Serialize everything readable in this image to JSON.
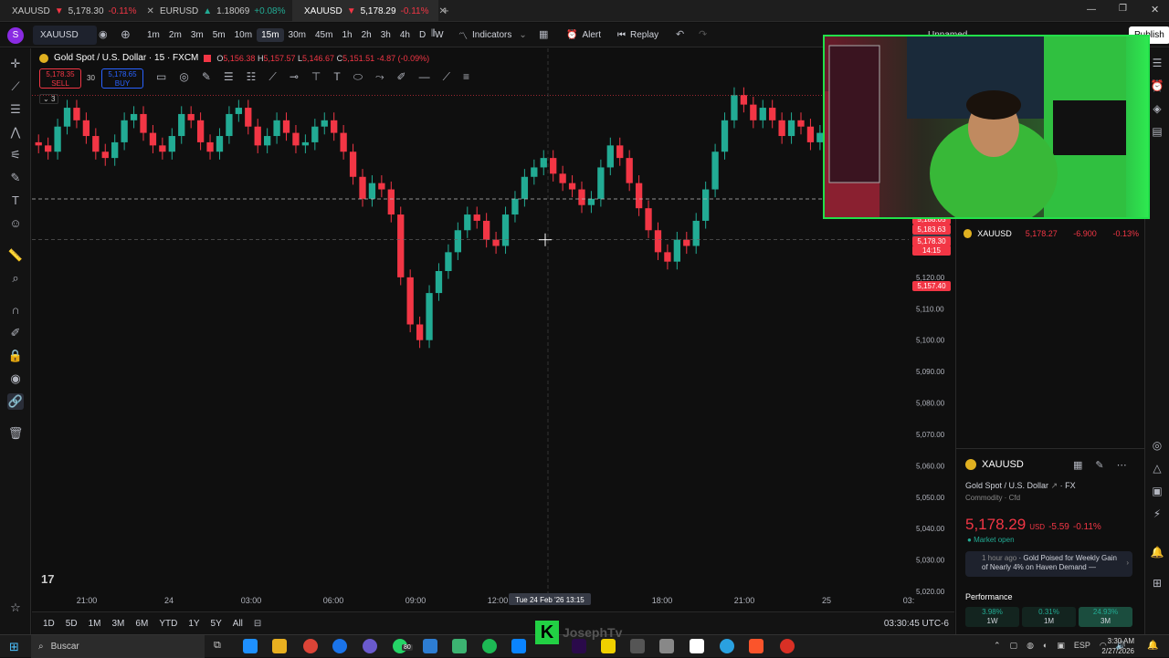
{
  "tabs": [
    {
      "symbol": "XAUUSD",
      "arrow": "▼",
      "price": "5,178.30",
      "change": "-0.11%",
      "active": false
    },
    {
      "symbol": "EURUSD",
      "arrow": "▲",
      "price": "1.18069",
      "change": "+0.08%",
      "active": false
    },
    {
      "symbol": "XAUUSD",
      "arrow": "▼",
      "price": "5,178.29",
      "change": "-0.11%",
      "active": true
    }
  ],
  "toolbar": {
    "symbol": "XAUUSD",
    "intervals": [
      "1m",
      "2m",
      "3m",
      "5m",
      "10m",
      "15m",
      "30m",
      "45m",
      "1h",
      "2h",
      "3h",
      "4h",
      "D",
      "W"
    ],
    "selected_interval": "15m",
    "indicators_label": "Indicators",
    "alert_label": "Alert",
    "replay_label": "Replay",
    "layout_name": "Unnamed",
    "publish_label": "Publish"
  },
  "legend": {
    "title": "Gold Spot / U.S. Dollar · 15 · FXCM",
    "o": "5,156.38",
    "h": "5,157.57",
    "l": "5,146.67",
    "c": "5,151.51",
    "chg": "-4.87 (-0.09%)",
    "sell_price": "5,178.35",
    "sell_label": "SELL",
    "spread": "30",
    "buy_price": "5,178.65",
    "buy_label": "BUY",
    "indicator_count": "3"
  },
  "chart_data": {
    "type": "candlestick",
    "symbol": "XAUUSD",
    "interval": "15",
    "x_ticks": [
      "21:00",
      "24",
      "03:00",
      "06:00",
      "09:00",
      "12:00",
      "15:00",
      "18:00",
      "21:00",
      "25",
      "03:"
    ],
    "y_ticks": [
      5180,
      5170,
      5160,
      5150,
      5140,
      5130,
      5120,
      5110,
      5100,
      5090,
      5080,
      5070,
      5060,
      5050,
      5040,
      5030,
      5020
    ],
    "ylim": [
      5020,
      5190
    ],
    "crosshair_price": "5,131.97",
    "crosshair_time": "Tue 24 Feb '26   13:15",
    "price_labels": [
      {
        "text": "5,188.05",
        "color": "#f23645"
      },
      {
        "text": "5,183.63",
        "color": "#f23645"
      },
      {
        "text": "5,178.30",
        "color": "#f23645"
      },
      {
        "text": "14:15",
        "color": "#f23645"
      },
      {
        "text": "5,157.40",
        "color": "#f23645"
      }
    ],
    "closes": [
      5162,
      5160,
      5168,
      5174,
      5170,
      5165,
      5160,
      5158,
      5163,
      5170,
      5172,
      5166,
      5162,
      5160,
      5165,
      5172,
      5170,
      5163,
      5160,
      5165,
      5172,
      5174,
      5168,
      5162,
      5165,
      5170,
      5166,
      5162,
      5163,
      5168,
      5170,
      5166,
      5160,
      5152,
      5145,
      5150,
      5148,
      5140,
      5120,
      5105,
      5100,
      5115,
      5122,
      5128,
      5135,
      5140,
      5138,
      5132,
      5130,
      5140,
      5145,
      5152,
      5155,
      5158,
      5153,
      5150,
      5148,
      5143,
      5145,
      5155,
      5162,
      5158,
      5150,
      5142,
      5135,
      5128,
      5125,
      5132,
      5130,
      5138,
      5148,
      5160,
      5170,
      5178,
      5175,
      5170,
      5174,
      5170,
      5165,
      5170,
      5168,
      5163,
      5166,
      5170,
      5174,
      5180,
      5188,
      5184,
      5180,
      5176,
      5175,
      5178
    ]
  },
  "watchlist": {
    "row_symbol": "XAUUSD",
    "row_price": "5,178.27",
    "row_change": "-6.900",
    "row_pct": "-0.13%"
  },
  "details": {
    "symbol": "XAUUSD",
    "name": "Gold Spot / U.S. Dollar",
    "exchange": "FX",
    "category": "Commodity · Cfd",
    "price": "5,178.29",
    "currency": "USD",
    "change": "-5.59",
    "change_pct": "-0.11%",
    "market_status": "Market open",
    "news_time": "1 hour ago",
    "news_text": "Gold Poised for Weekly Gain of Nearly 4% on Haven Demand —",
    "performance_label": "Performance",
    "perf": [
      {
        "value": "3.98%",
        "period": "1W"
      },
      {
        "value": "0.31%",
        "period": "1M"
      },
      {
        "value": "24.93%",
        "period": "3M"
      }
    ]
  },
  "bottom": {
    "ranges": [
      "1D",
      "5D",
      "1M",
      "3M",
      "6M",
      "YTD",
      "1Y",
      "5Y",
      "All"
    ],
    "clock": "03:30:45 UTC-6"
  },
  "taskbar": {
    "search_placeholder": "Buscar",
    "lang": "ESP",
    "time": "3:30 AM",
    "date": "2/27/2026",
    "badge": "80"
  },
  "overlay": {
    "watermark": "JosephTv"
  }
}
